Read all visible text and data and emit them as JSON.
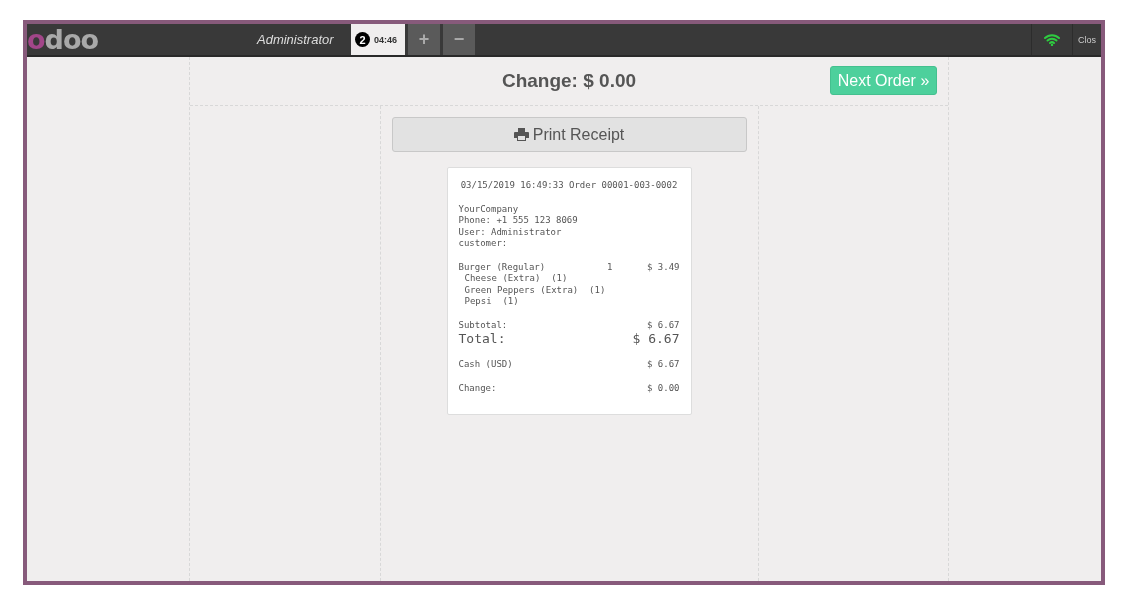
{
  "topbar": {
    "logo": "odoo",
    "user": "Administrator",
    "orders": [
      {
        "number": "2",
        "time": "04:46",
        "selected": true
      }
    ],
    "add_button": "+",
    "remove_button": "−",
    "close_button": "Clos"
  },
  "screen": {
    "change_title": "Change: $ 0.00",
    "next_order": "Next Order »",
    "print_receipt": "Print Receipt"
  },
  "receipt": {
    "header": "03/15/2019 16:49:33 Order 00001-003-0002",
    "company_lines": [
      "YourCompany",
      "Phone: +1 555 123 8069",
      "User: Administrator",
      "customer:"
    ],
    "lines": [
      {
        "product": "Burger (Regular)",
        "qty": "1",
        "price": "$ 3.49",
        "extras": [
          "Cheese (Extra)  (1)",
          "Green Peppers (Extra)  (1)",
          "Pepsi  (1)"
        ]
      }
    ],
    "subtotal": {
      "label": "Subtotal:",
      "value": "$ 6.67"
    },
    "total": {
      "label": "Total:",
      "value": "$ 6.67"
    },
    "payment": {
      "label": "Cash (USD)",
      "value": "$ 6.67"
    },
    "change": {
      "label": "Change:",
      "value": "$ 0.00"
    }
  }
}
